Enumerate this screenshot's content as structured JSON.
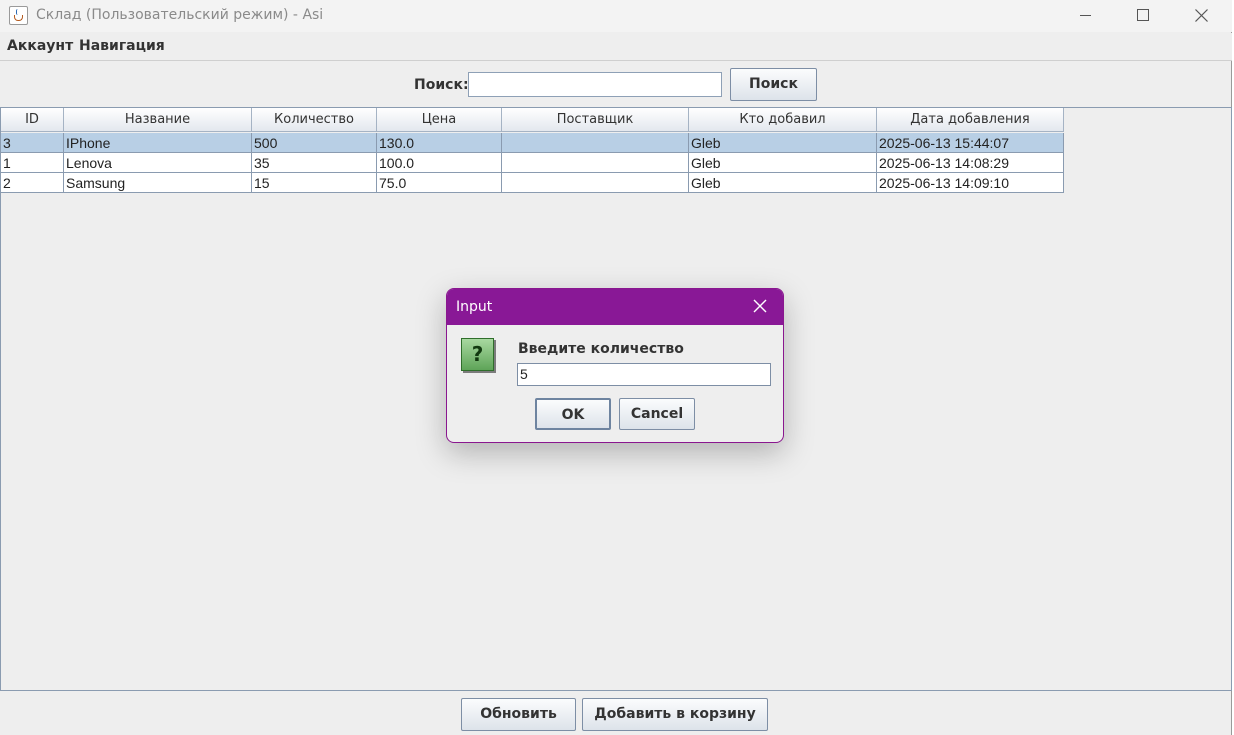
{
  "window": {
    "title": "Склад (Пользовательский режим) - Asi"
  },
  "menu": {
    "account": "Аккаунт",
    "navigation": "Навигация"
  },
  "search": {
    "label": "Поиск:",
    "value": "",
    "button": "Поиск"
  },
  "table": {
    "columns": [
      "ID",
      "Название",
      "Количество",
      "Цена",
      "Поставщик",
      "Кто добавил",
      "Дата добавления"
    ],
    "rows": [
      {
        "selected": true,
        "cells": [
          "3",
          "IPhone",
          "500",
          "130.0",
          "",
          "Gleb",
          "2025-06-13 15:44:07"
        ]
      },
      {
        "selected": false,
        "cells": [
          "1",
          "Lenova",
          "35",
          "100.0",
          "",
          "Gleb",
          "2025-06-13 14:08:29"
        ]
      },
      {
        "selected": false,
        "cells": [
          "2",
          "Samsung",
          "15",
          "75.0",
          "",
          "Gleb",
          "2025-06-13 14:09:10"
        ]
      }
    ]
  },
  "bottom": {
    "refresh": "Обновить",
    "add_to_cart": "Добавить в корзину"
  },
  "dialog": {
    "title": "Input",
    "prompt": "Введите количество",
    "value": "5",
    "ok": "OK",
    "cancel": "Cancel",
    "icon_glyph": "?"
  },
  "colors": {
    "dialog_titlebar": "#891896",
    "selection": "#b8cfe5",
    "window_bg": "#eeeeee"
  },
  "icons": {
    "app": "java-cup-icon",
    "dialog": "question-icon"
  }
}
